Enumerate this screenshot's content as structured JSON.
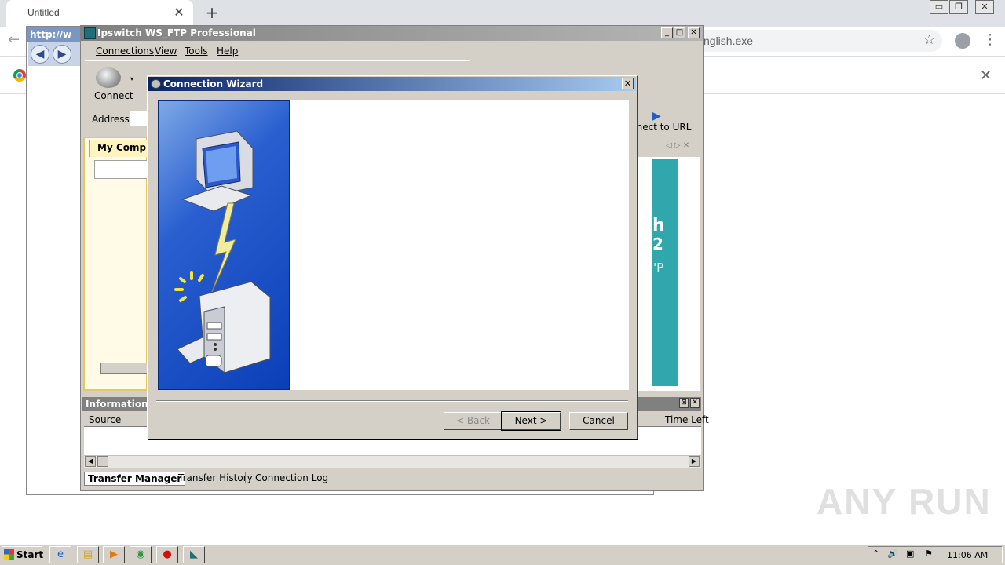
{
  "browser": {
    "tab_title": "Untitled",
    "omnibox_text": "nglish.exe",
    "tab_close": "✕",
    "new_tab": "+",
    "back": "←",
    "star": "☆",
    "menu": "⋮",
    "infobar_close": "✕",
    "window_controls": [
      "▭",
      "❐",
      "✕"
    ]
  },
  "ie": {
    "url_text": "http://w",
    "back_glyph": "◀",
    "forward_glyph": "▶"
  },
  "ftp": {
    "title": "Ipswitch WS_FTP Professional",
    "window_buttons": [
      "_",
      "□",
      "✕"
    ],
    "menu": [
      "Connections",
      "View",
      "Tools",
      "Help"
    ],
    "toolbar": {
      "connect_label": "Connect",
      "dropdown_glyph": "▾"
    },
    "address_label": "Address",
    "connect_url_label": "nnect to URL",
    "connect_url_glyph": "▶",
    "local_tab_label": "My Comput",
    "remote_nav": "◁ ▷ ✕",
    "banner": {
      "line1": "h",
      "line2": "2",
      "line3": "'P"
    },
    "info_title": "Information W",
    "info_btns": [
      "⊠",
      "✕"
    ],
    "columns": {
      "source": "Source",
      "time_left": "Time Left"
    },
    "scroll_left": "◀",
    "scroll_right": "▶",
    "bottom_tabs": [
      "Transfer Manager",
      "Transfer History",
      "Connection Log"
    ]
  },
  "wizard": {
    "title": "Connection Wizard",
    "close": "✕",
    "buttons": {
      "back": "< Back",
      "next": "Next >",
      "cancel": "Cancel"
    }
  },
  "taskbar": {
    "start": "Start",
    "clock": "11:06 AM",
    "tray_icons": [
      "⌃",
      "🔊",
      "▣",
      "⚑"
    ]
  },
  "watermark": "ANY RUN"
}
